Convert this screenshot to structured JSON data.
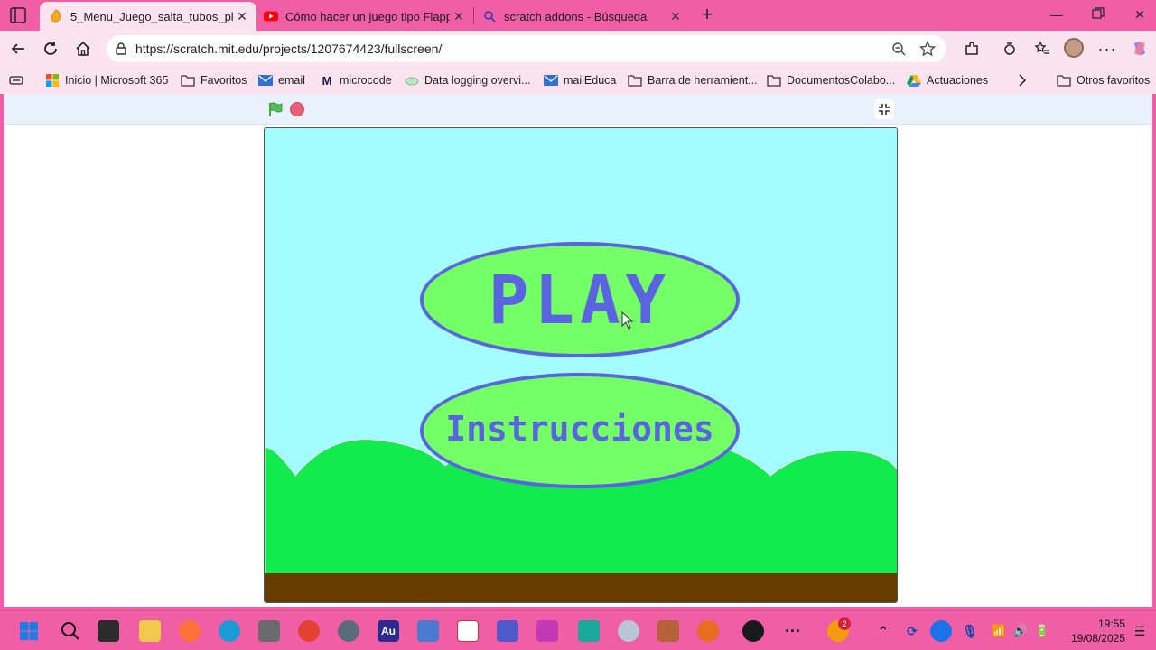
{
  "browser": {
    "tabs": [
      {
        "title": "5_Menu_Juego_salta_tubos_play_",
        "active": true
      },
      {
        "title": "Cómo hacer un juego tipo Flappy",
        "active": false
      },
      {
        "title": "scratch addons - Búsqueda",
        "active": false
      }
    ],
    "url": "https://scratch.mit.edu/projects/1207674423/fullscreen/",
    "favorites": [
      {
        "label": "Inicio | Microsoft 365",
        "icon": "microsoft-icon"
      },
      {
        "label": "Favoritos",
        "icon": "folder-icon"
      },
      {
        "label": "email",
        "icon": "mail-icon"
      },
      {
        "label": "microcode",
        "icon": "microcode-icon"
      },
      {
        "label": "Data logging overvi...",
        "icon": "cloud-icon"
      },
      {
        "label": "mailEduca",
        "icon": "mail-icon"
      },
      {
        "label": "Barra de herramient...",
        "icon": "folder-icon"
      },
      {
        "label": "DocumentosColabo...",
        "icon": "folder-icon"
      },
      {
        "label": "Actuaciones",
        "icon": "drive-icon"
      },
      {
        "label": "Otros favoritos",
        "icon": "folder-icon"
      }
    ]
  },
  "scratch": {
    "play_label": "PLAY",
    "instructions_label": "Instrucciones"
  },
  "taskbar": {
    "time": "19:55",
    "date": "19/08/2025",
    "notification_count": "2",
    "app_icon_labels": {
      "audition": "Au"
    }
  },
  "colors": {
    "chrome_pink": "#f05fa5",
    "sky": "#a3fcff",
    "grass": "#12eb4d",
    "ground": "#663c00",
    "button_fill": "#74ff67",
    "button_outline": "#5a63e0"
  }
}
